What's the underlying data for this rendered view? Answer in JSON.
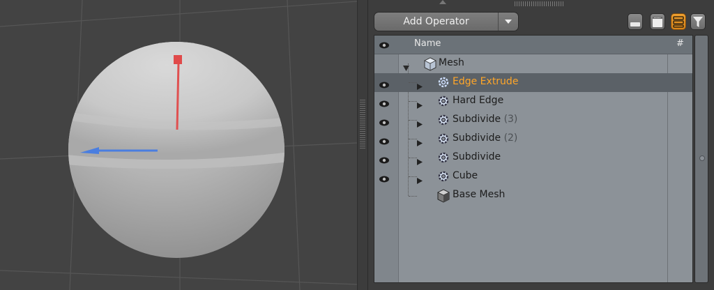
{
  "toolbar": {
    "add_operator_label": "Add Operator",
    "dropdown_icon": "chevron-down-icon",
    "buttons": [
      {
        "icon": "minus-icon"
      },
      {
        "icon": "clipboard-icon"
      },
      {
        "icon": "list-view-icon",
        "active": true
      },
      {
        "icon": "filter-icon"
      }
    ]
  },
  "list": {
    "header": {
      "name": "Name",
      "count": "#"
    },
    "items": [
      {
        "label": "Mesh",
        "count": "",
        "visible": false,
        "icon": "mesh-cube-icon",
        "expanded": true
      },
      {
        "label": "Edge Extrude",
        "count": "",
        "visible": true,
        "icon": "gear-icon",
        "selected": true
      },
      {
        "label": "Hard Edge",
        "count": "",
        "visible": true,
        "icon": "gear-icon"
      },
      {
        "label": "Subdivide",
        "count": "(3)",
        "visible": true,
        "icon": "gear-icon"
      },
      {
        "label": "Subdivide",
        "count": "(2)",
        "visible": true,
        "icon": "gear-icon"
      },
      {
        "label": "Subdivide",
        "count": "",
        "visible": true,
        "icon": "gear-icon"
      },
      {
        "label": "Cube",
        "count": "",
        "visible": true,
        "icon": "gear-icon"
      },
      {
        "label": "Base Mesh",
        "count": "",
        "visible": false,
        "icon": "mesh-cube-icon"
      }
    ]
  },
  "colors": {
    "selected_text": "#ffa629",
    "viewport_bg": "#434343",
    "list_bg": "#8c9298",
    "x_axis": "#e05050",
    "z_axis": "#4a7ee0"
  }
}
